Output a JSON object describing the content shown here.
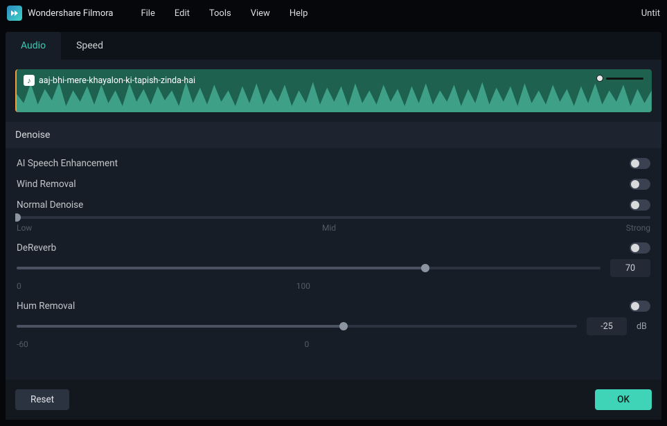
{
  "app": {
    "name": "Wondershare Filmora",
    "doc": "Untit"
  },
  "menu": [
    "File",
    "Edit",
    "Tools",
    "View",
    "Help"
  ],
  "tabs": {
    "audio": "Audio",
    "speed": "Speed"
  },
  "clip": {
    "name": "aaj-bhi-mere-khayalon-ki-tapish-zinda-hai"
  },
  "section": "Denoise",
  "controls": {
    "aiSpeech": {
      "label": "AI Speech Enhancement",
      "on": false
    },
    "windRemoval": {
      "label": "Wind Removal",
      "on": false
    },
    "normalDenoise": {
      "label": "Normal Denoise",
      "on": false,
      "scale": {
        "left": "Low",
        "mid": "Mid",
        "right": "Strong"
      },
      "valuePct": 0
    },
    "dereverb": {
      "label": "DeReverb",
      "on": false,
      "scale": {
        "left": "0",
        "right": "100"
      },
      "value": 70,
      "valuePct": 70
    },
    "humRemoval": {
      "label": "Hum Removal",
      "on": false,
      "scale": {
        "left": "-60",
        "right": "0"
      },
      "value": -25,
      "unit": "dB",
      "valuePct": 58.3
    }
  },
  "buttons": {
    "reset": "Reset",
    "ok": "OK"
  }
}
